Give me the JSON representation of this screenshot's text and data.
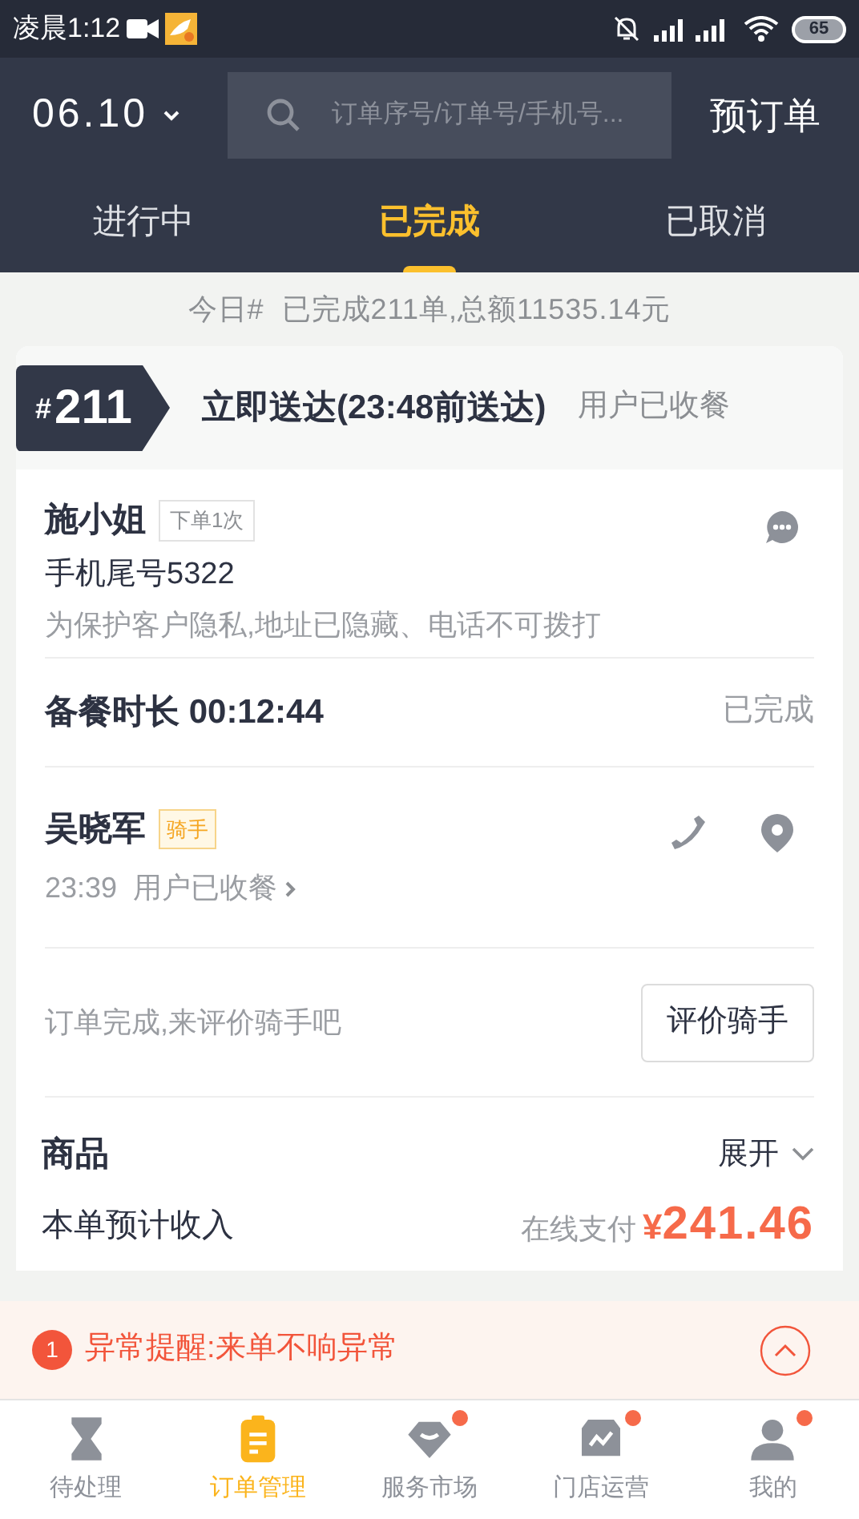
{
  "status_bar": {
    "time": "凌晨1:12",
    "battery": "65"
  },
  "header": {
    "date": "06.10",
    "search": {
      "placeholder": "订单序号/订单号/手机号..."
    },
    "preorder": "预订单"
  },
  "tabs": [
    {
      "label": "进行中",
      "selected": false
    },
    {
      "label": "已完成",
      "selected": true
    },
    {
      "label": "已取消",
      "selected": false
    }
  ],
  "summary": "今日#  已完成211单,总额11535.14元",
  "order": {
    "prefix": "#",
    "number": "211",
    "delivery": "立即送达(23:48前送达)",
    "status": "用户已收餐",
    "customer": {
      "name": "施小姐",
      "tag": "下单1次",
      "phone": "手机尾号5322",
      "note": "为保护客户隐私,地址已隐藏、电话不可拨打"
    },
    "prep": {
      "label": "备餐时长 00:12:44",
      "status": "已完成"
    },
    "rider": {
      "name": "吴晓军",
      "tag": "骑手",
      "status": "23:39  用户已收餐"
    },
    "rate": {
      "prompt": "订单完成,来评价骑手吧",
      "button": "评价骑手"
    },
    "goods": {
      "label": "商品",
      "expand": "展开"
    },
    "income": {
      "label": "本单预计收入",
      "method": "在线支付",
      "currency": "¥",
      "amount": "241.46"
    }
  },
  "alert": {
    "count": "1",
    "text": "异常提醒:来单不响异常"
  },
  "nav": [
    {
      "label": "待处理",
      "selected": false,
      "badge": false
    },
    {
      "label": "订单管理",
      "selected": true,
      "badge": false
    },
    {
      "label": "服务市场",
      "selected": false,
      "badge": true
    },
    {
      "label": "门店运营",
      "selected": false,
      "badge": true
    },
    {
      "label": "我的",
      "selected": false,
      "badge": true
    }
  ]
}
